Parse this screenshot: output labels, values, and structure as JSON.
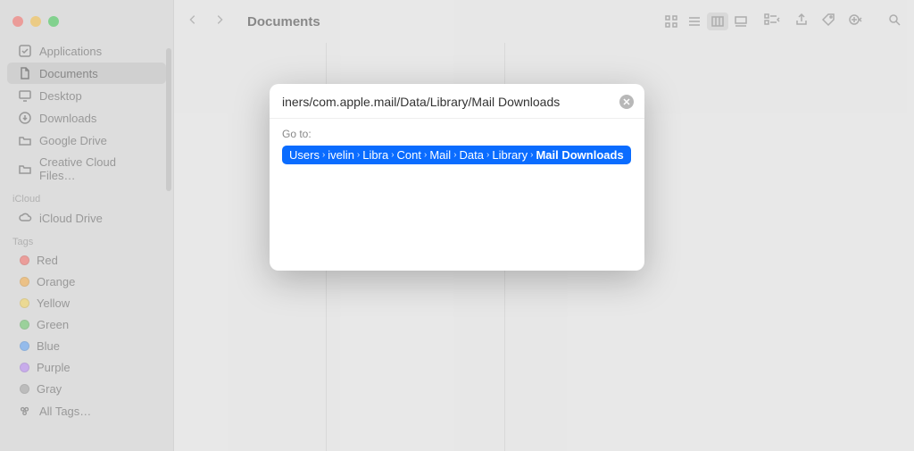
{
  "window": {
    "title": "Documents"
  },
  "sidebar": {
    "favorites": [
      {
        "label": "Applications"
      },
      {
        "label": "Documents"
      },
      {
        "label": "Desktop"
      },
      {
        "label": "Downloads"
      },
      {
        "label": "Google Drive"
      },
      {
        "label": "Creative Cloud Files…"
      }
    ],
    "icloud_header": "iCloud",
    "icloud": [
      {
        "label": "iCloud Drive"
      }
    ],
    "tags_header": "Tags",
    "tags": [
      {
        "label": "Red",
        "color": "#ff6059"
      },
      {
        "label": "Orange",
        "color": "#ffaa33"
      },
      {
        "label": "Yellow",
        "color": "#ffd94a"
      },
      {
        "label": "Green",
        "color": "#5cc95c"
      },
      {
        "label": "Blue",
        "color": "#4d9dff"
      },
      {
        "label": "Purple",
        "color": "#b87dff"
      },
      {
        "label": "Gray",
        "color": "#a0a0a0"
      },
      {
        "label": "All Tags…",
        "color": null
      }
    ]
  },
  "modal": {
    "input_value": "iners/com.apple.mail/Data/Library/Mail Downloads",
    "goto_label": "Go to:",
    "segments": [
      "Users",
      "ivelin",
      "Libra",
      "Cont",
      "Mail",
      "Data",
      "Library",
      "Mail Downloads"
    ]
  }
}
